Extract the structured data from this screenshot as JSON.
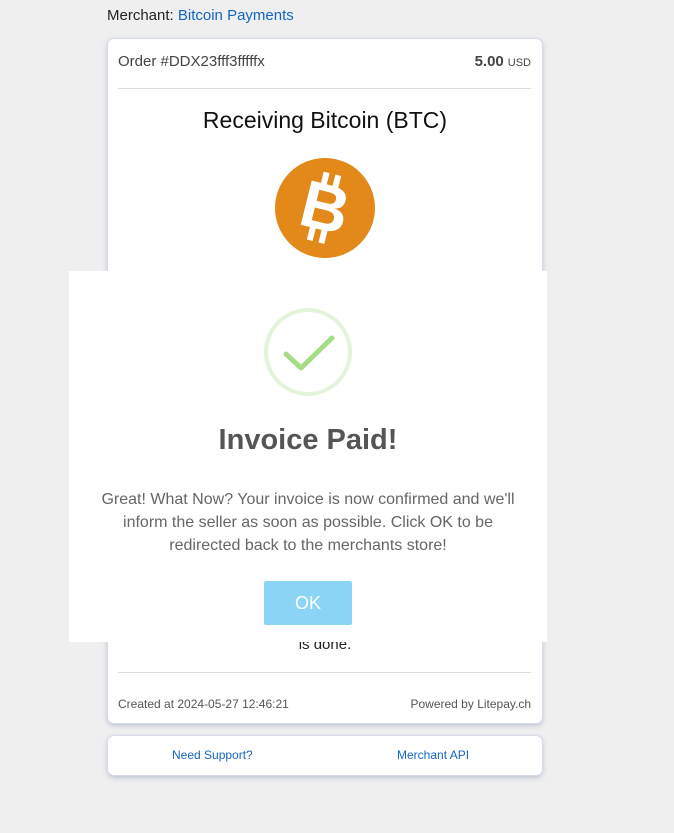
{
  "merchant": {
    "label": "Merchant:",
    "name": "Bitcoin Payments"
  },
  "order": {
    "label": "Order #DDX23fff3fffffx",
    "amount": "5.00",
    "currency": "USD"
  },
  "receiving_title": "Receiving Bitcoin (BTC)",
  "btc_icon": "bitcoin-logo-icon",
  "card_bottom_text": "is done.",
  "footer": {
    "created": "Created at 2024-05-27 12:46:21",
    "powered": "Powered by Litepay.ch"
  },
  "links": {
    "support": "Need Support?",
    "api": "Merchant API"
  },
  "modal": {
    "icon": "success-check-icon",
    "title": "Invoice Paid!",
    "text": "Great! What Now? Your invoice is now confirmed and we'll inform the seller as soon as possible. Click OK to be redirected back to the merchants store!",
    "ok_label": "OK"
  },
  "colors": {
    "accent": "#1565c0",
    "bitcoin": "#e2891a",
    "ok_button": "#8cd4f5",
    "check": "#a5dc86"
  }
}
